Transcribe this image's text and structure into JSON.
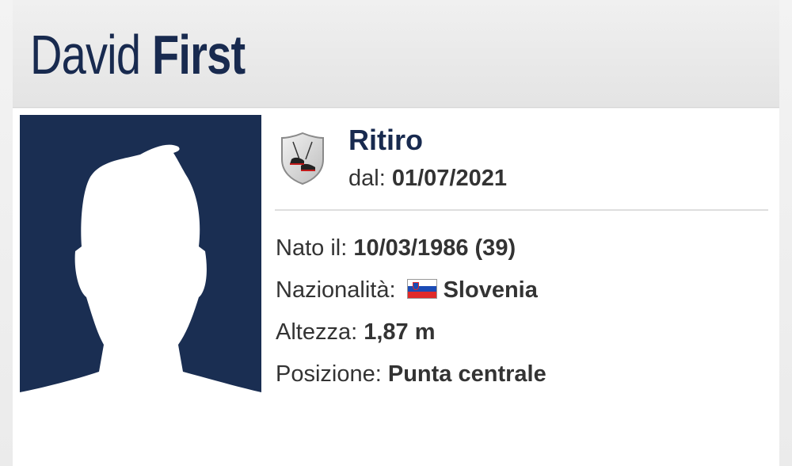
{
  "player": {
    "first_name": "David",
    "last_name": "First"
  },
  "career": {
    "status": "Ritiro",
    "since_label": "dal:",
    "since_value": "01/07/2021"
  },
  "details": {
    "birth_label": "Nato il:",
    "birth_value": "10/03/1986 (39)",
    "nationality_label": "Nazionalità:",
    "nationality_value": "Slovenia",
    "height_label": "Altezza:",
    "height_value": "1,87 m",
    "position_label": "Posizione:",
    "position_value": "Punta centrale"
  },
  "icons": {
    "photo": "player-silhouette-icon",
    "club": "retired-boots-shield-icon",
    "flag": "slovenia-flag-icon"
  },
  "colors": {
    "navy": "#182a4f",
    "photo_bg": "#1a2e52",
    "text": "#333333"
  }
}
